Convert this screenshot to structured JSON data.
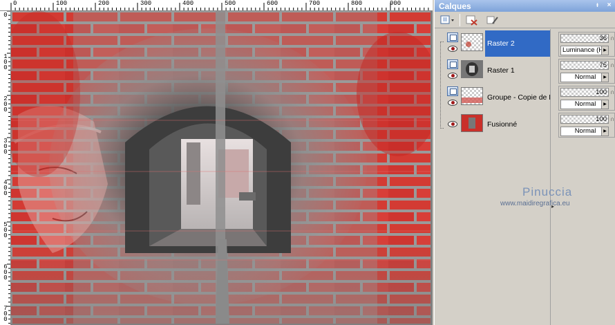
{
  "rulers": {
    "horizontal_labels": [
      "0",
      "100",
      "200",
      "300",
      "400",
      "500",
      "600",
      "700",
      "800",
      "900"
    ],
    "vertical_labels": [
      "0",
      "1\n0\n0",
      "2\n0\n0",
      "3\n0\n0",
      "4\n0\n0",
      "5\n0\n0",
      "6\n0\n0",
      "7\n0\n0"
    ]
  },
  "panel": {
    "title": "Calques",
    "pin_label": "ᵼ",
    "close_label": "×"
  },
  "layers": [
    {
      "name": "Raster 2",
      "selected": true,
      "opacity": "36",
      "blend": "Luminance (H)"
    },
    {
      "name": "Raster 1",
      "selected": false,
      "opacity": "75",
      "blend": "Normal"
    },
    {
      "name": "Groupe - Copie de Fus",
      "selected": false,
      "opacity": "100",
      "blend": "Normal"
    },
    {
      "name": "Fusionné",
      "selected": false,
      "opacity": "100",
      "blend": "Normal"
    }
  ],
  "watermark": {
    "title": "Pinuccia",
    "url": "www.maidiregrafica.eu"
  },
  "icons": {
    "new_layer": "new-layer-icon",
    "delete_layer": "delete-layer-icon",
    "properties": "layer-properties-icon",
    "visibility": "eye-icon",
    "lock": "lock-icon"
  },
  "colors": {
    "title_bar": "#7ea3d9",
    "selected_row": "#316ac5",
    "brick_red": "#d6302c"
  }
}
